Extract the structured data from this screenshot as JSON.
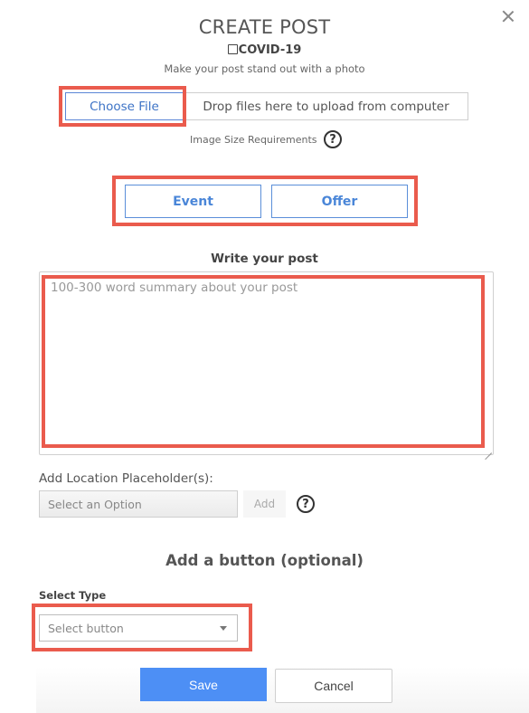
{
  "dialog": {
    "title": "CREATE POST",
    "close_icon": "close-icon",
    "covid_checkbox": {
      "label": "COVID-19",
      "checked": false
    },
    "subtitle": "Make your post stand out with a photo"
  },
  "upload": {
    "choose_file_label": "Choose File",
    "drop_text": "Drop files here to upload from computer",
    "image_requirements_label": "Image Size Requirements",
    "help_icon": "question-circle-icon",
    "help_glyph": "?"
  },
  "post_type": {
    "buttons": [
      {
        "label": "Event"
      },
      {
        "label": "Offer"
      }
    ]
  },
  "post": {
    "label": "Write your post",
    "value": "",
    "placeholder": "100-300 word summary about your post"
  },
  "location": {
    "label": "Add Location Placeholder(s):",
    "select_placeholder": "Select an Option",
    "add_label": "Add",
    "help_glyph": "?"
  },
  "cta": {
    "heading": "Add a button (optional)",
    "select_type_label": "Select Type",
    "select_value": "Select button",
    "dropdown_icon": "caret-down-icon"
  },
  "footer": {
    "save_label": "Save",
    "cancel_label": "Cancel"
  },
  "colors": {
    "accent_blue": "#4d8ff5",
    "link_blue": "#3d73c6",
    "highlight_red": "#ea5b4d"
  }
}
